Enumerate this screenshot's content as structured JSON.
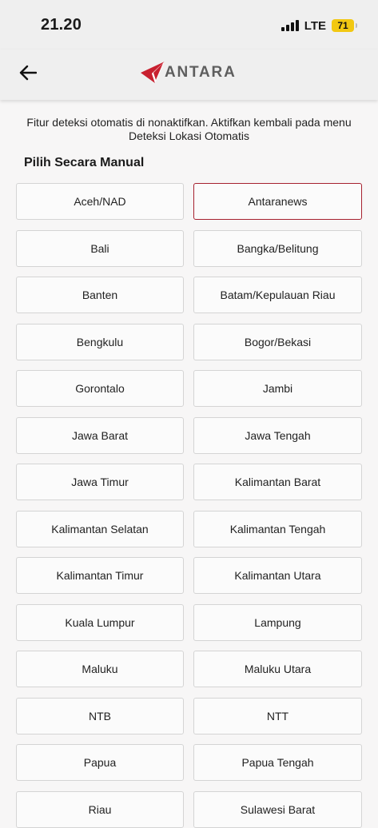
{
  "status": {
    "time": "21.20",
    "network": "LTE",
    "battery": "71"
  },
  "appbar": {
    "back_icon": "arrow-left-icon",
    "logo_text": "ANTARA",
    "logo_accent": "#c8202f"
  },
  "notice": "Fitur deteksi otomatis di nonaktifkan. Aktifkan kembali pada menu Deteksi Lokasi Otomatis",
  "section_title": "Pilih Secara Manual",
  "selected_color": "#a6212f",
  "regions": [
    {
      "label": "Aceh/NAD",
      "selected": false
    },
    {
      "label": "Antaranews",
      "selected": true
    },
    {
      "label": "Bali",
      "selected": false
    },
    {
      "label": "Bangka/Belitung",
      "selected": false
    },
    {
      "label": "Banten",
      "selected": false
    },
    {
      "label": "Batam/Kepulauan Riau",
      "selected": false
    },
    {
      "label": "Bengkulu",
      "selected": false
    },
    {
      "label": "Bogor/Bekasi",
      "selected": false
    },
    {
      "label": "Gorontalo",
      "selected": false
    },
    {
      "label": "Jambi",
      "selected": false
    },
    {
      "label": "Jawa Barat",
      "selected": false
    },
    {
      "label": "Jawa Tengah",
      "selected": false
    },
    {
      "label": "Jawa Timur",
      "selected": false
    },
    {
      "label": "Kalimantan Barat",
      "selected": false
    },
    {
      "label": "Kalimantan Selatan",
      "selected": false
    },
    {
      "label": "Kalimantan Tengah",
      "selected": false
    },
    {
      "label": "Kalimantan Timur",
      "selected": false
    },
    {
      "label": "Kalimantan Utara",
      "selected": false
    },
    {
      "label": "Kuala Lumpur",
      "selected": false
    },
    {
      "label": "Lampung",
      "selected": false
    },
    {
      "label": "Maluku",
      "selected": false
    },
    {
      "label": "Maluku Utara",
      "selected": false
    },
    {
      "label": "NTB",
      "selected": false
    },
    {
      "label": "NTT",
      "selected": false
    },
    {
      "label": "Papua",
      "selected": false
    },
    {
      "label": "Papua Tengah",
      "selected": false
    },
    {
      "label": "Riau",
      "selected": false
    },
    {
      "label": "Sulawesi Barat",
      "selected": false
    }
  ]
}
